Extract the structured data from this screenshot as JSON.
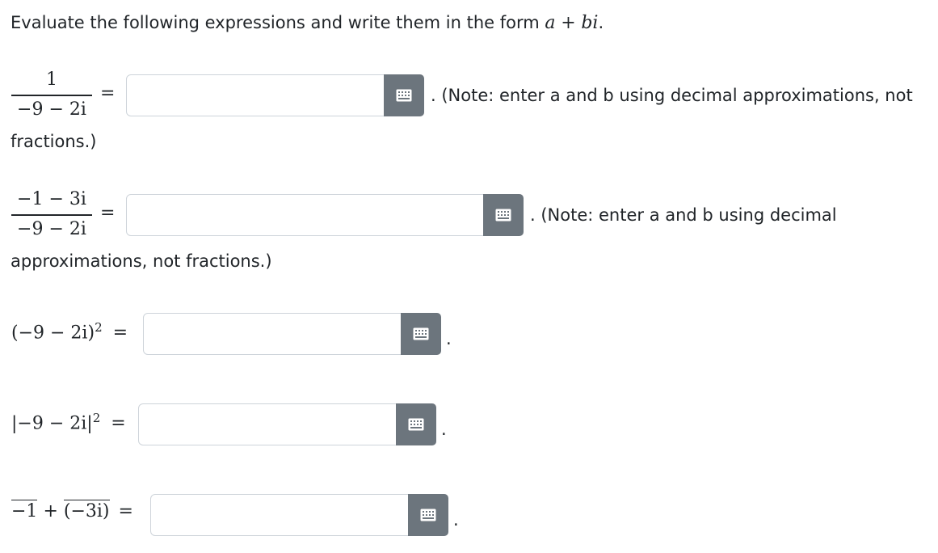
{
  "instructions": {
    "prefix": "Evaluate the following expressions and write them in the form",
    "form_a": "a",
    "form_plus": "+",
    "form_bi": "bi",
    "suffix": "."
  },
  "problems": [
    {
      "numerator": "1",
      "denominator": "−9 − 2i",
      "equals": "=",
      "answer": "",
      "note_line1": ". (Note: enter a and b using decimal approximations, not",
      "note_line2": "fractions.)"
    },
    {
      "numerator": "−1 − 3i",
      "denominator": "−9 − 2i",
      "equals": "=",
      "answer": "",
      "note_line1": ". (Note: enter a and b using decimal",
      "note_line2": "approximations, not fractions.)"
    },
    {
      "expression": "(−9 − 2i)",
      "exponent": "2",
      "equals": "=",
      "answer": "",
      "trailing": "."
    },
    {
      "expression": "|−9 − 2i|",
      "exponent": "2",
      "equals": "=",
      "answer": "",
      "trailing": "."
    },
    {
      "conj_left": "−1",
      "plus": "+",
      "conj_right": "(−3i)",
      "equals": "=",
      "answer": "",
      "trailing": "."
    }
  ],
  "keyboard_icon": "keyboard-icon"
}
